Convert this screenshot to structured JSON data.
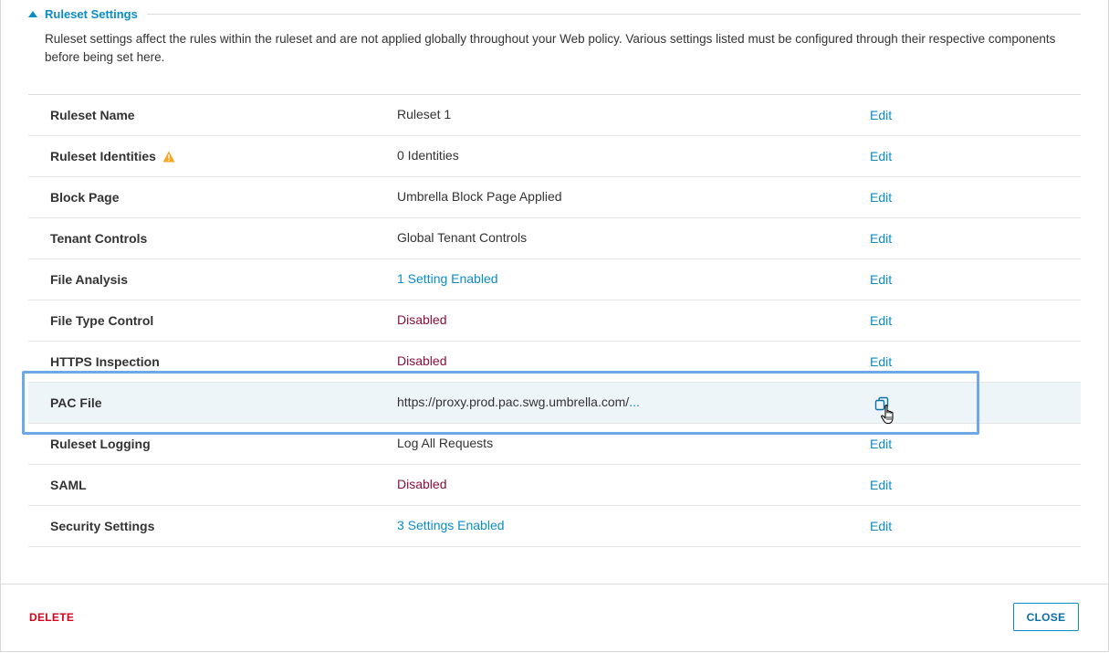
{
  "section": {
    "title": "Ruleset Settings",
    "description": "Ruleset settings affect the rules within the ruleset and are not applied globally throughout your Web policy. Various settings listed must be configured through their respective components before being set here."
  },
  "rows": [
    {
      "name": "Ruleset Name",
      "value": "Ruleset 1",
      "action": "Edit"
    },
    {
      "name": "Ruleset Identities",
      "value": "0 Identities",
      "action": "Edit"
    },
    {
      "name": "Block Page",
      "value": "Umbrella Block Page Applied",
      "action": "Edit"
    },
    {
      "name": "Tenant Controls",
      "value": "Global Tenant Controls",
      "action": "Edit"
    },
    {
      "name": "File Analysis",
      "value": "1 Setting Enabled",
      "action": "Edit"
    },
    {
      "name": "File Type Control",
      "value": "Disabled",
      "action": "Edit"
    },
    {
      "name": "HTTPS Inspection",
      "value": "Disabled",
      "action": "Edit"
    },
    {
      "name": "PAC File",
      "value": "https://proxy.prod.pac.swg.umbrella.com/",
      "value_more": "...",
      "action": ""
    },
    {
      "name": "Ruleset Logging",
      "value": "Log All Requests",
      "action": "Edit"
    },
    {
      "name": "SAML",
      "value": "Disabled",
      "action": "Edit"
    },
    {
      "name": "Security Settings",
      "value": "3 Settings Enabled",
      "action": "Edit"
    }
  ],
  "icons": {
    "warning": "warning-triangle-icon",
    "copy": "copy-icon",
    "cursor": "hand-pointer-icon"
  },
  "colors": {
    "accent": "#0a8cc9",
    "disabled": "#8a0f3c",
    "warning": "#f5a623",
    "delete": "#d0021b",
    "highlight": "#6ea8e8"
  },
  "footer": {
    "delete_label": "DELETE",
    "close_label": "CLOSE"
  }
}
